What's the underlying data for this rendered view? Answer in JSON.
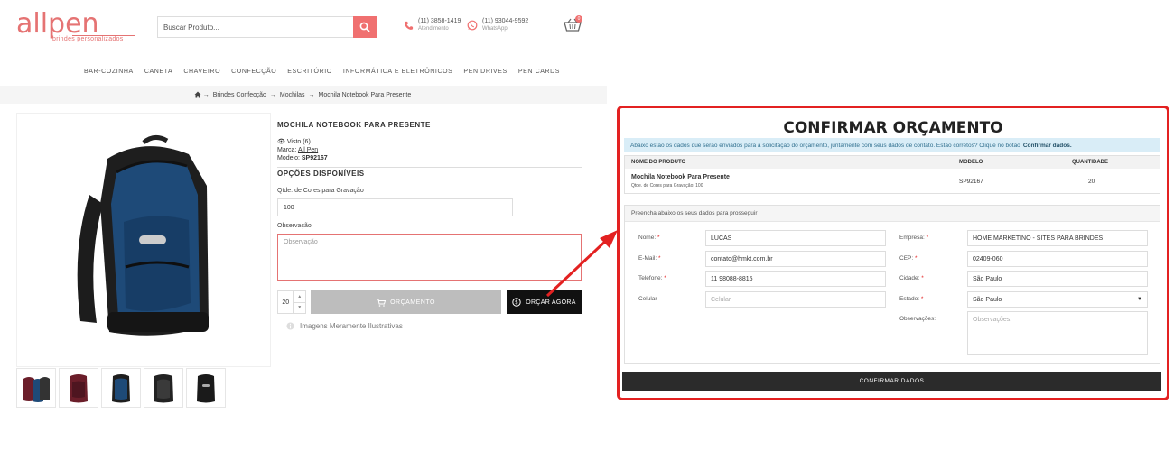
{
  "logo": {
    "word": "allpen",
    "tagline": "brindes personalizados"
  },
  "search": {
    "placeholder": "Buscar Produto..."
  },
  "contacts": [
    {
      "number": "(11) 3858-1419",
      "label": "Atendimento"
    },
    {
      "number": "(11) 93044-9592",
      "label": "WhatsApp"
    }
  ],
  "cart": {
    "count": "0"
  },
  "nav": [
    "BAR-COZINHA",
    "CANETA",
    "CHAVEIRO",
    "CONFECÇÃO",
    "ESCRITÓRIO",
    "INFORMÁTICA E ELETRÔNICOS",
    "PEN DRIVES",
    "PEN CARDS"
  ],
  "breadcrumb": [
    "Brindes Confecção",
    "Mochilas",
    "Mochila Notebook Para Presente"
  ],
  "product": {
    "title": "MOCHILA NOTEBOOK PARA PRESENTE",
    "views": "Visto (6)",
    "brand_label": "Marca:",
    "brand": "All Pen",
    "model_label": "Modelo:",
    "model": "SP92167",
    "options_title": "OPÇÕES DISPONÍVEIS",
    "colors_label": "Qtde. de Cores para Gravação",
    "colors_value": "100",
    "obs_label": "Observação",
    "obs_placeholder": "Observação",
    "qty": "20",
    "btn_orcamento": "ORÇAMENTO",
    "btn_orcar_agora": "ORÇAR AGORA",
    "note": "Imagens Meramente Ilustrativas"
  },
  "modal": {
    "title": "CONFIRMAR ORÇAMENTO",
    "info": "Abaixo estão os dados que serão enviados para a solicitação do orçamento, juntamente com seus dados de contato. Estão corretos? Clique no botão",
    "info_bold": "Confirmar dados.",
    "table": {
      "headers": [
        "NOME DO PRODUTO",
        "MODELO",
        "QUANTIDADE"
      ],
      "row": {
        "name": "Mochila Notebook Para Presente",
        "sub": "Qtde. de Cores para Gravação: 100",
        "model": "SP92167",
        "qty": "20"
      }
    },
    "form_head": "Preencha abaixo os seus dados para prosseguir",
    "fields": {
      "nome_label": "Nome:",
      "nome": "LUCAS",
      "email_label": "E-Mail:",
      "email": "contato@hmkt.com.br",
      "tel_label": "Telefone:",
      "tel": "11 98088-8815",
      "cel_label": "Celular",
      "cel_placeholder": "Celular",
      "empresa_label": "Empresa:",
      "empresa": "HOME MARKETINO - SITES PARA BRINDES",
      "cep_label": "CEP:",
      "cep": "02409-060",
      "cidade_label": "Cidade:",
      "cidade": "São Paulo",
      "estado_label": "Estado:",
      "estado": "São Paulo",
      "obs_label": "Observações:",
      "obs_placeholder": "Observações:"
    },
    "confirm_btn": "CONFIRMAR DADOS"
  },
  "colors": {
    "accent": "#f07070",
    "highlight": "#e32121",
    "dark": "#111111"
  }
}
